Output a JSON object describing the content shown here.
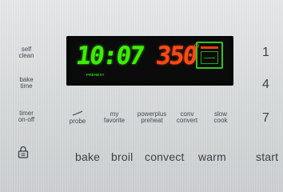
{
  "left_buttons": {
    "self_clean": "self\nclean",
    "bake_time": "bake\ntime",
    "timer_onoff": "timer\non-off"
  },
  "display": {
    "clock": "10:07",
    "temperature": "350",
    "degree": "°",
    "indicator": "PREHEAT",
    "clock_color": "#3cf000",
    "temp_color": "#ff4a14"
  },
  "function_row": {
    "probe": "probe",
    "my_favorite": "my\nfavorite",
    "powerplus_preheat": "powerplus\npreheat",
    "conv_convert": "conv\nconvert",
    "slow_cook": "slow\ncook"
  },
  "keypad": {
    "k1": "1",
    "k4": "4",
    "k7": "7"
  },
  "bottom_row": {
    "bake": "bake",
    "broil": "broil",
    "convect": "convect",
    "warm": "warm",
    "start": "start"
  },
  "icons": {
    "lock": "lock-icon",
    "probe": "probe-icon",
    "oven": "oven-icon"
  }
}
